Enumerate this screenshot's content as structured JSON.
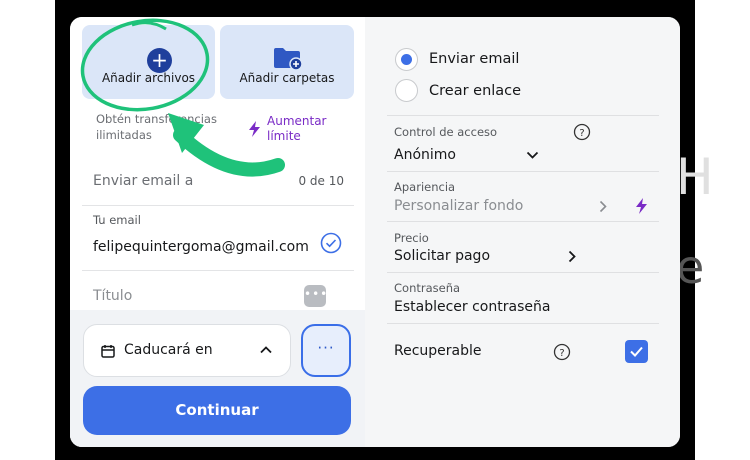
{
  "upload": {
    "add_files_label": "Añadir archivos",
    "add_folders_label": "Añadir carpetas"
  },
  "promo": {
    "text": "Obtén transferencias ilimitadas",
    "upgrade_label": "Aumentar límite"
  },
  "form": {
    "email_to_placeholder": "Enviar email a",
    "email_count": "0 de 10",
    "your_email_label": "Tu email",
    "your_email_value": "felipequintergoma@gmail.com",
    "title_placeholder": "Título"
  },
  "footer": {
    "expiry_label": "Caducará en",
    "more_label": "···",
    "continue_label": "Continuar"
  },
  "options": {
    "send_email_label": "Enviar email",
    "send_email_selected": true,
    "create_link_label": "Crear enlace",
    "access_control_label": "Control de acceso",
    "access_control_value": "Anónimo",
    "appearance_label": "Apariencia",
    "appearance_value": "Personalizar fondo",
    "price_label": "Precio",
    "price_value": "Solicitar pago",
    "password_label": "Contraseña",
    "password_value": "Establecer contraseña",
    "recoverable_label": "Recuperable",
    "recoverable_checked": true
  },
  "background": {
    "ghost_letter_1": "H",
    "ghost_letter_2": "e"
  },
  "colors": {
    "accent": "#3d6fe6",
    "tile": "#dbe6f8",
    "premium": "#7a2bc6",
    "annotation": "#1fc27a"
  },
  "icons": {
    "add_files": "plus-circle-icon",
    "add_folders": "folder-plus-icon",
    "upgrade": "lightning-bolt-icon",
    "email_verified": "check-circle-icon",
    "title_field": "more-dots-icon",
    "expiry": "calendar-icon",
    "help": "question-circle-icon"
  }
}
